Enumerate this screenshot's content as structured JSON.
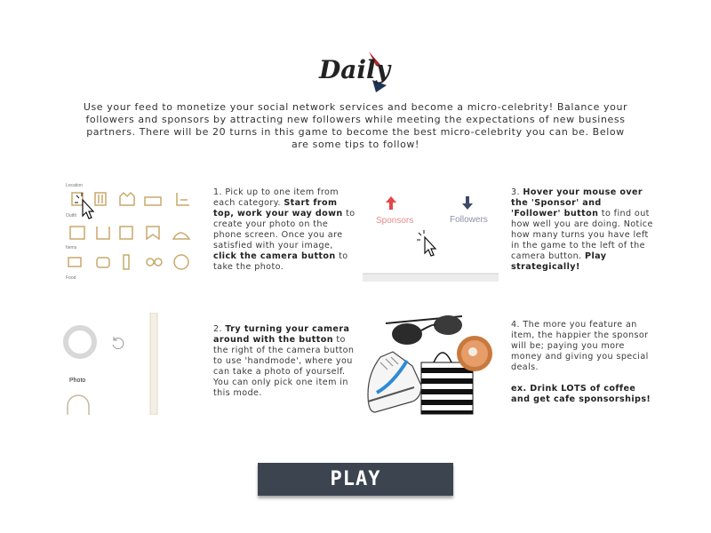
{
  "logo": {
    "text": "Daily"
  },
  "intro": "Use your feed to monetize your social network services and become a micro-celebrity! Balance your followers and sponsors by attracting new followers while meeting the expectations of new business partners. There will be 20 turns in this game to become the best micro-celebrity you can be. Below are some tips to follow!",
  "tips": [
    {
      "pre": "1. Pick up to one item from each category. ",
      "bold1": "Start from top, work your way down",
      "mid": " to create your photo on the phone screen. Once you are satisfied with your image, ",
      "bold2": "click the camera button",
      "post": " to take the photo."
    },
    {
      "pre": "2. ",
      "bold1": "Try turning your camera around with the button",
      "post": " to the right of the camera button to use 'handmode', where you can take a photo of yourself. You can only pick one item in this mode."
    },
    {
      "pre": "3. ",
      "bold1": "Hover your mouse over the 'Sponsor' and 'Follower' button",
      "mid": " to find out how well you are doing. Notice how many turns you have left in the game to the left of the camera button. ",
      "bold2": "Play strategically!"
    },
    {
      "text": "4. The more you feature an item, the happier the sponsor will be; paying you more money and giving you special deals.",
      "example": "ex. Drink LOTS of coffee and get cafe sponsorships!"
    }
  ],
  "img1": {
    "categories": [
      "Location",
      "Outfit",
      "Items",
      "Food"
    ]
  },
  "img2": {
    "photo_label": "Photo"
  },
  "img3": {
    "sponsors_label": "Sponsors",
    "followers_label": "Followers"
  },
  "play_button": {
    "label": "PLAY"
  },
  "colors": {
    "button_bg": "#3c4450",
    "sponsor_red": "#e54646",
    "follower_navy": "#3d4a66",
    "icon_gold": "#c8a96b"
  }
}
